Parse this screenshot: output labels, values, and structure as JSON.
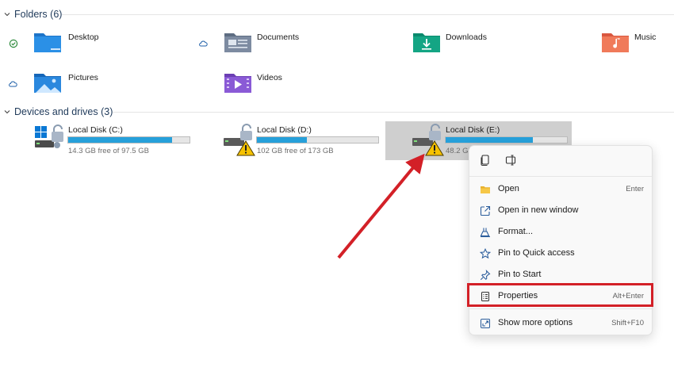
{
  "sections": {
    "folders_header": "Folders (6)",
    "drives_header": "Devices and drives (3)"
  },
  "folders": [
    {
      "name": "Desktop",
      "status": "synced"
    },
    {
      "name": "Documents",
      "status": "cloud"
    },
    {
      "name": "Downloads",
      "status": ""
    },
    {
      "name": "Music",
      "status": ""
    },
    {
      "name": "Pictures",
      "status": "cloud"
    },
    {
      "name": "Videos",
      "status": ""
    }
  ],
  "drives": [
    {
      "name": "Local Disk (C:)",
      "free": "14.3 GB free of 97.5 GB",
      "used_fraction": 0.853
    },
    {
      "name": "Local Disk (D:)",
      "free": "102 GB free of 173 GB",
      "used_fraction": 0.41
    },
    {
      "name": "Local Disk (E:)",
      "free": "48.2 GB",
      "used_fraction": 0.72
    }
  ],
  "context_menu": {
    "top_icons": [
      "copy-icon",
      "rename-icon"
    ],
    "items": [
      {
        "label": "Open",
        "shortcut": "Enter",
        "icon": "folder-open-icon"
      },
      {
        "label": "Open in new window",
        "shortcut": "",
        "icon": "open-new-window-icon"
      },
      {
        "label": "Format...",
        "shortcut": "",
        "icon": "format-icon"
      },
      {
        "label": "Pin to Quick access",
        "shortcut": "",
        "icon": "star-icon"
      },
      {
        "label": "Pin to Start",
        "shortcut": "",
        "icon": "pin-icon"
      },
      {
        "label": "Properties",
        "shortcut": "Alt+Enter",
        "icon": "properties-icon"
      },
      {
        "label": "Show more options",
        "shortcut": "Shift+F10",
        "icon": "show-more-icon"
      }
    ]
  },
  "colors": {
    "accent_bar": "#26a0da",
    "annotation_red": "#d32027",
    "selection_gray": "#cfcfcf"
  }
}
